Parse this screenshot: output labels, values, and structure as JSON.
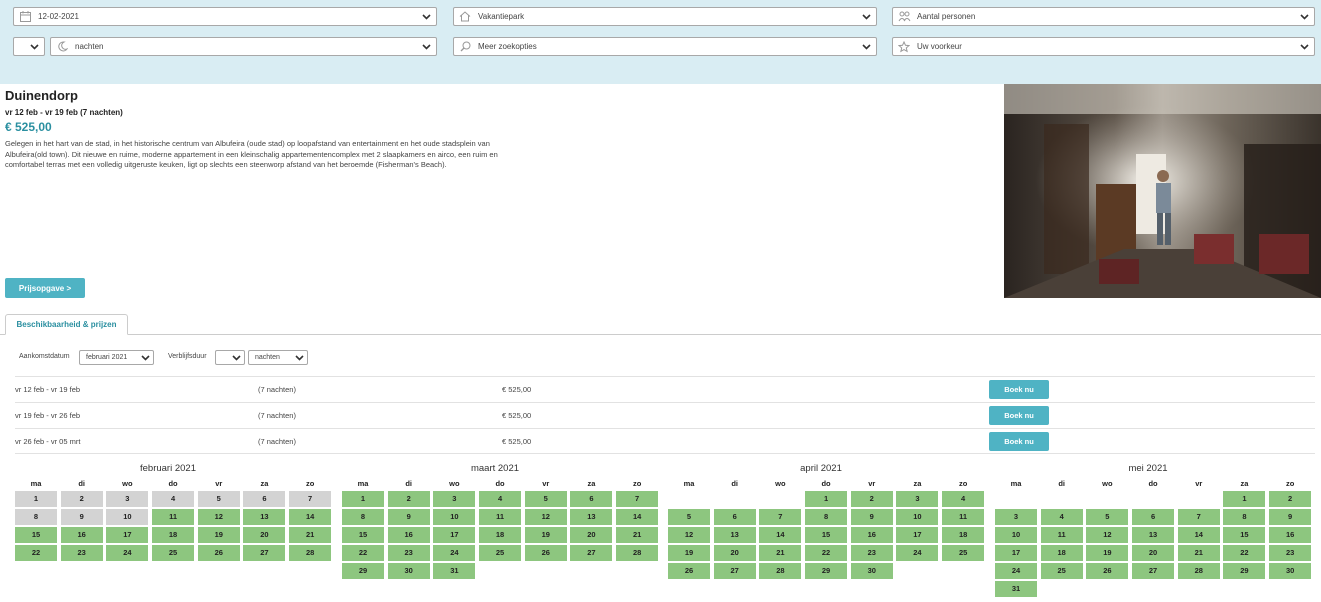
{
  "search": {
    "date": "12-02-2021",
    "type": "Vakantiepark",
    "persons": "Aantal personen",
    "nights_count": "",
    "nights": "nachten",
    "more": "Meer zoekopties",
    "preference": "Uw voorkeur"
  },
  "listing": {
    "title": "Duinendorp",
    "dates": "vr 12 feb - vr 19 feb (7 nachten)",
    "price": "€ 525,00",
    "description": "Gelegen in het hart van de stad, in het historische centrum van Albufeira (oude stad) op loopafstand van entertainment en het oude stadsplein van Albufeira(old town). Dit nieuwe en ruime, moderne appartement in een kleinschalig appartementencomplex met 2 slaapkamers en airco, een ruim en comfortabel terras met een volledig uitgeruste keuken, ligt op slechts een steenworp afstand van het beroemde (Fisherman's Beach).",
    "quote_button": "Prijsopgave >"
  },
  "tabs": {
    "availability": "Beschikbaarheid & prijzen"
  },
  "filters": {
    "arrival_label": "Aankomstdatum",
    "arrival_value": "februari 2021",
    "duration_label": "Verblijfsduur",
    "duration_count": "",
    "duration_unit": "nachten"
  },
  "results": [
    {
      "dates": "vr 12 feb - vr 19 feb",
      "nights": "(7 nachten)",
      "price": "€ 525,00",
      "button": "Boek nu"
    },
    {
      "dates": "vr 19 feb - vr 26 feb",
      "nights": "(7 nachten)",
      "price": "€ 525,00",
      "button": "Boek nu"
    },
    {
      "dates": "vr 26 feb - vr 05 mrt",
      "nights": "(7 nachten)",
      "price": "€ 525,00",
      "button": "Boek nu"
    }
  ],
  "weekdays": [
    "ma",
    "di",
    "wo",
    "do",
    "vr",
    "za",
    "zo"
  ],
  "calendars": [
    {
      "month": "februari 2021",
      "offset": 0,
      "days": 28,
      "unavailable": [
        1,
        2,
        3,
        4,
        5,
        6,
        7,
        8,
        9,
        10
      ]
    },
    {
      "month": "maart 2021",
      "offset": 0,
      "days": 31,
      "unavailable": []
    },
    {
      "month": "april 2021",
      "offset": 3,
      "days": 30,
      "unavailable": []
    },
    {
      "month": "mei 2021",
      "offset": 5,
      "days": 31,
      "unavailable": []
    }
  ],
  "colors": {
    "header_bg": "#d9edf3",
    "accent": "#4fb3c4",
    "price": "#2a8fa0",
    "available": "#8dc67f",
    "unavailable": "#d3d3d3"
  }
}
